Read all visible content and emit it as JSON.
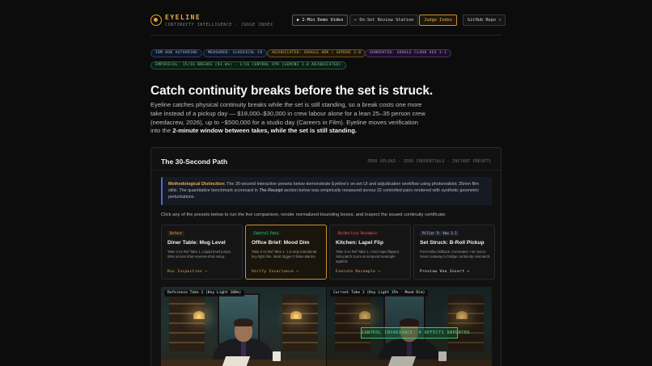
{
  "header": {
    "brand": "EYELINE",
    "tagline": "CONTINUITY INTELLIGENCE · JUDGE INDEX",
    "nav": {
      "demo": "▶ 2-Min Demo Video",
      "review": "← On-Set Review Station",
      "judge": "Judge Index",
      "github": "GitHub Repo ↗"
    }
  },
  "badges": {
    "b1": "IBM BOB AUTHORING",
    "b2": "MEASURED: CLASSICAL CV",
    "b3": "ADJUDICATED: GOOGLE ADK / GEMINI 3.0",
    "b4": "GENERATED: GOOGLE CLOUD VEO 3.1",
    "b5": "EMPIRICAL: 15/16 BREAKS (93.8%) · 1/16 CONTROL FPR (GEMINI 3.0 ADJUDICATED)"
  },
  "hero": {
    "title": "Catch continuity breaks before the set is struck.",
    "lead_plain": "Eyeline catches physical continuity breaks while the set is still standing, so a break costs one more take instead of a pickup day — $18,000–$30,000 in crew labour alone for a lean 25–35 person crew (needacrew, 2026), up to ~$500,000 for a studio day (Careers in Film). Eyeline moves verification into the ",
    "lead_bold": "2-minute window between takes, while the set is still standing."
  },
  "panel": {
    "title": "The 30-Second Path",
    "meta": "ZERO UPLOAD · ZERO CREDENTIALS · INSTANT PRESETS",
    "note": {
      "label": "Methodological Distinction:",
      "text1": " The 30-second interactive presets below demonstrate Eyeline's on-set UI and adjudication workflow using photorealistic 35mm film stills. The quantitative benchmark scorecard in ",
      "italic": "The Receipt",
      "text2": " section below was empirically measured across 32 controlled pairs rendered with synthetic geometric perturbations."
    },
    "instructions": "Click any of the presets below to run the live comparison, render normalized bounding boxes, and inspect the issued continuity certificate:",
    "cards": [
      {
        "tag": "Defect",
        "title": "Diner Table: Mug Level",
        "desc": "Take 4 vs Ref Take 1. Liquid level jumps 55% across shot-reverse-shot setup.",
        "action": "Run Inspection →"
      },
      {
        "tag": "Control Pass",
        "title": "Office Brief: Mood Dim",
        "desc": "Take 2 vs Ref Take 1. 1.5-stop intentional key light dim. Must trigger 0 false alarms.",
        "action": "Verify Invariance →"
      },
      {
        "tag": "Borderline Resample",
        "title": "Kitchen: Lapel Flip",
        "desc": "Take 3 vs Ref Take 1. Actor lapel flipped. Sub-patch zoom & temporal resample applied.",
        "action": "Execute Resample →"
      },
      {
        "tag": "Pillar 5: Veo 3.1",
        "title": "Set Struck: B-Roll Pickup",
        "desc": "Post-strike fallback: Generates ~4s macro insert cutaway to bridge continuity mismatch.",
        "action": "Preview Veo Insert →"
      }
    ],
    "viewer": {
      "left_label": "Reference Take 1 (Key Light 100%)",
      "right_label": "Current Take 2 (Key Light 35% · Mood Dim)",
      "overlay": "CONTROL INVARIANCE: 0 DEFECTS REPORTED"
    }
  },
  "colors": {
    "accent": "#e8b04a",
    "defect": "#e0b050",
    "control": "#45e08a",
    "borderline": "#e06a6a",
    "pillar": "#9ab8e8"
  }
}
